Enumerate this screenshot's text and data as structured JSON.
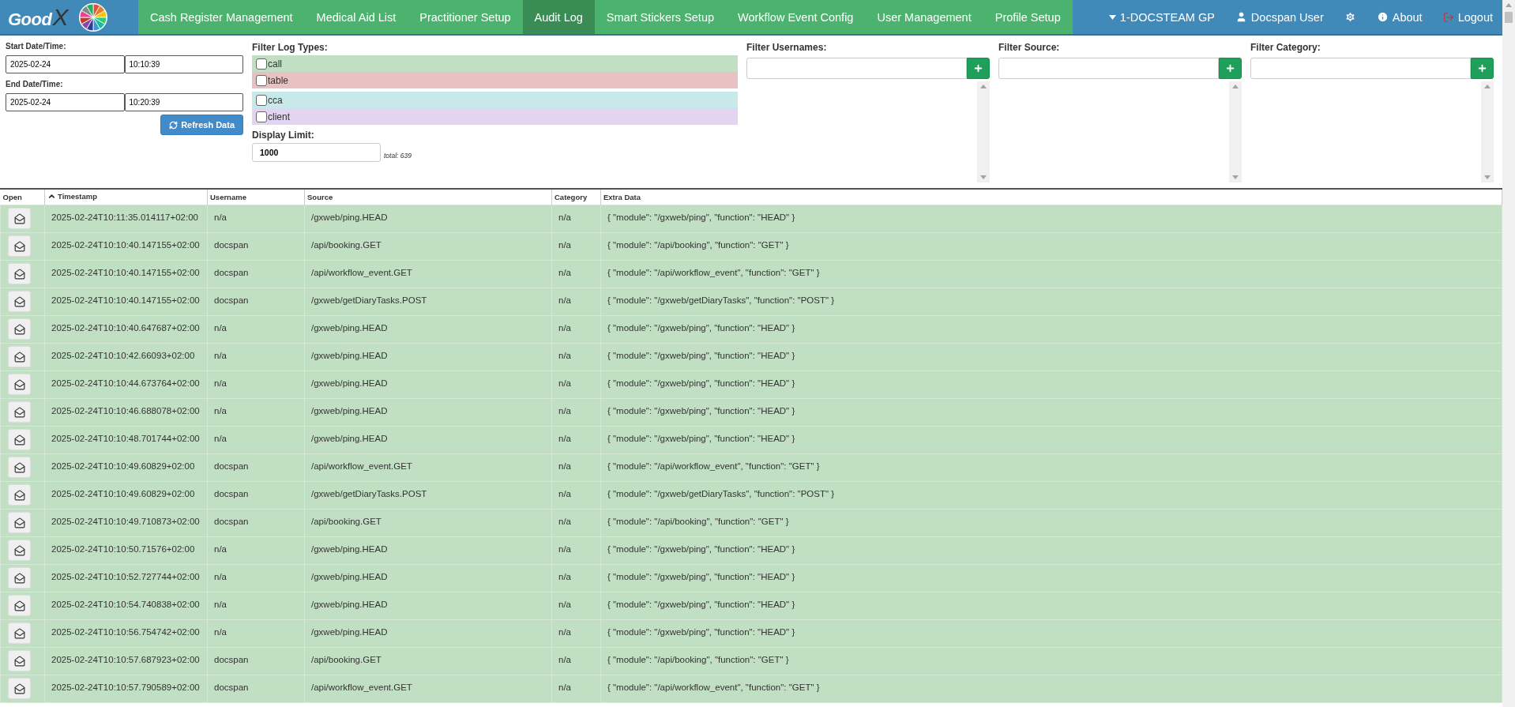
{
  "logo": {
    "text": "Good",
    "mark": "X"
  },
  "nav": {
    "items": [
      {
        "label": "Cash Register Management",
        "selected": false
      },
      {
        "label": "Medical Aid List",
        "selected": false
      },
      {
        "label": "Practitioner Setup",
        "selected": false
      },
      {
        "label": "Audit Log",
        "selected": true
      },
      {
        "label": "Smart Stickers Setup",
        "selected": false
      },
      {
        "label": "Workflow Event Config",
        "selected": false
      },
      {
        "label": "User Management",
        "selected": false
      },
      {
        "label": "Profile Setup",
        "selected": false
      }
    ],
    "right": [
      {
        "kind": "caret",
        "label": "1-DOCSTEAM GP"
      },
      {
        "kind": "user",
        "label": "Docspan User"
      },
      {
        "kind": "gear"
      },
      {
        "kind": "info",
        "label": "About"
      },
      {
        "kind": "logout",
        "label": "Logout"
      }
    ]
  },
  "dates": {
    "start_label": "Start Date/Time:",
    "start_date": "2025-02-24",
    "start_time": "10:10:39",
    "end_label": "End Date/Time:",
    "end_date": "2025-02-24",
    "end_time": "10:20:39",
    "refresh": "Refresh Data"
  },
  "log_types": {
    "label": "Filter Log Types:",
    "groups": [
      {
        "items": [
          {
            "label": "call",
            "checked": false,
            "color": "#c1dfc3"
          },
          {
            "label": "table",
            "checked": false,
            "color": "#e8c2c2"
          }
        ]
      },
      {
        "items": [
          {
            "label": "cca",
            "checked": false,
            "color": "#c8e9e9"
          },
          {
            "label": "client",
            "checked": false,
            "color": "#e3d5f2"
          }
        ]
      }
    ]
  },
  "display_limit": {
    "label": "Display Limit:",
    "value": "1000",
    "total": "total: 639"
  },
  "filters": [
    {
      "label": "Filter Usernames:"
    },
    {
      "label": "Filter Source:"
    },
    {
      "label": "Filter Category:"
    }
  ],
  "table": {
    "columns": [
      "Open",
      "Timestamp",
      "Username",
      "Source",
      "Category",
      "Extra Data"
    ],
    "rows": [
      [
        "",
        "2025-02-24T10:11:35.014117+02:00",
        "n/a",
        "/gxweb/ping.HEAD",
        "n/a",
        "{ \"module\": \"/gxweb/ping\", \"function\": \"HEAD\" }"
      ],
      [
        "",
        "2025-02-24T10:10:40.147155+02:00",
        "docspan",
        "/api/booking.GET",
        "n/a",
        "{ \"module\": \"/api/booking\", \"function\": \"GET\" }"
      ],
      [
        "",
        "2025-02-24T10:10:40.147155+02:00",
        "docspan",
        "/api/workflow_event.GET",
        "n/a",
        "{ \"module\": \"/api/workflow_event\", \"function\": \"GET\" }"
      ],
      [
        "",
        "2025-02-24T10:10:40.147155+02:00",
        "docspan",
        "/gxweb/getDiaryTasks.POST",
        "n/a",
        "{ \"module\": \"/gxweb/getDiaryTasks\", \"function\": \"POST\" }"
      ],
      [
        "",
        "2025-02-24T10:10:40.647687+02:00",
        "n/a",
        "/gxweb/ping.HEAD",
        "n/a",
        "{ \"module\": \"/gxweb/ping\", \"function\": \"HEAD\" }"
      ],
      [
        "",
        "2025-02-24T10:10:42.66093+02:00",
        "n/a",
        "/gxweb/ping.HEAD",
        "n/a",
        "{ \"module\": \"/gxweb/ping\", \"function\": \"HEAD\" }"
      ],
      [
        "",
        "2025-02-24T10:10:44.673764+02:00",
        "n/a",
        "/gxweb/ping.HEAD",
        "n/a",
        "{ \"module\": \"/gxweb/ping\", \"function\": \"HEAD\" }"
      ],
      [
        "",
        "2025-02-24T10:10:46.688078+02:00",
        "n/a",
        "/gxweb/ping.HEAD",
        "n/a",
        "{ \"module\": \"/gxweb/ping\", \"function\": \"HEAD\" }"
      ],
      [
        "",
        "2025-02-24T10:10:48.701744+02:00",
        "n/a",
        "/gxweb/ping.HEAD",
        "n/a",
        "{ \"module\": \"/gxweb/ping\", \"function\": \"HEAD\" }"
      ],
      [
        "",
        "2025-02-24T10:10:49.60829+02:00",
        "docspan",
        "/api/workflow_event.GET",
        "n/a",
        "{ \"module\": \"/api/workflow_event\", \"function\": \"GET\" }"
      ],
      [
        "",
        "2025-02-24T10:10:49.60829+02:00",
        "docspan",
        "/gxweb/getDiaryTasks.POST",
        "n/a",
        "{ \"module\": \"/gxweb/getDiaryTasks\", \"function\": \"POST\" }"
      ],
      [
        "",
        "2025-02-24T10:10:49.710873+02:00",
        "docspan",
        "/api/booking.GET",
        "n/a",
        "{ \"module\": \"/api/booking\", \"function\": \"GET\" }"
      ],
      [
        "",
        "2025-02-24T10:10:50.71576+02:00",
        "n/a",
        "/gxweb/ping.HEAD",
        "n/a",
        "{ \"module\": \"/gxweb/ping\", \"function\": \"HEAD\" }"
      ],
      [
        "",
        "2025-02-24T10:10:52.727744+02:00",
        "n/a",
        "/gxweb/ping.HEAD",
        "n/a",
        "{ \"module\": \"/gxweb/ping\", \"function\": \"HEAD\" }"
      ],
      [
        "",
        "2025-02-24T10:10:54.740838+02:00",
        "n/a",
        "/gxweb/ping.HEAD",
        "n/a",
        "{ \"module\": \"/gxweb/ping\", \"function\": \"HEAD\" }"
      ],
      [
        "",
        "2025-02-24T10:10:56.754742+02:00",
        "n/a",
        "/gxweb/ping.HEAD",
        "n/a",
        "{ \"module\": \"/gxweb/ping\", \"function\": \"HEAD\" }"
      ],
      [
        "",
        "2025-02-24T10:10:57.687923+02:00",
        "docspan",
        "/api/booking.GET",
        "n/a",
        "{ \"module\": \"/api/booking\", \"function\": \"GET\" }"
      ],
      [
        "",
        "2025-02-24T10:10:57.790589+02:00",
        "docspan",
        "/api/workflow_event.GET",
        "n/a",
        "{ \"module\": \"/api/workflow_event\", \"function\": \"GET\" }"
      ]
    ]
  }
}
